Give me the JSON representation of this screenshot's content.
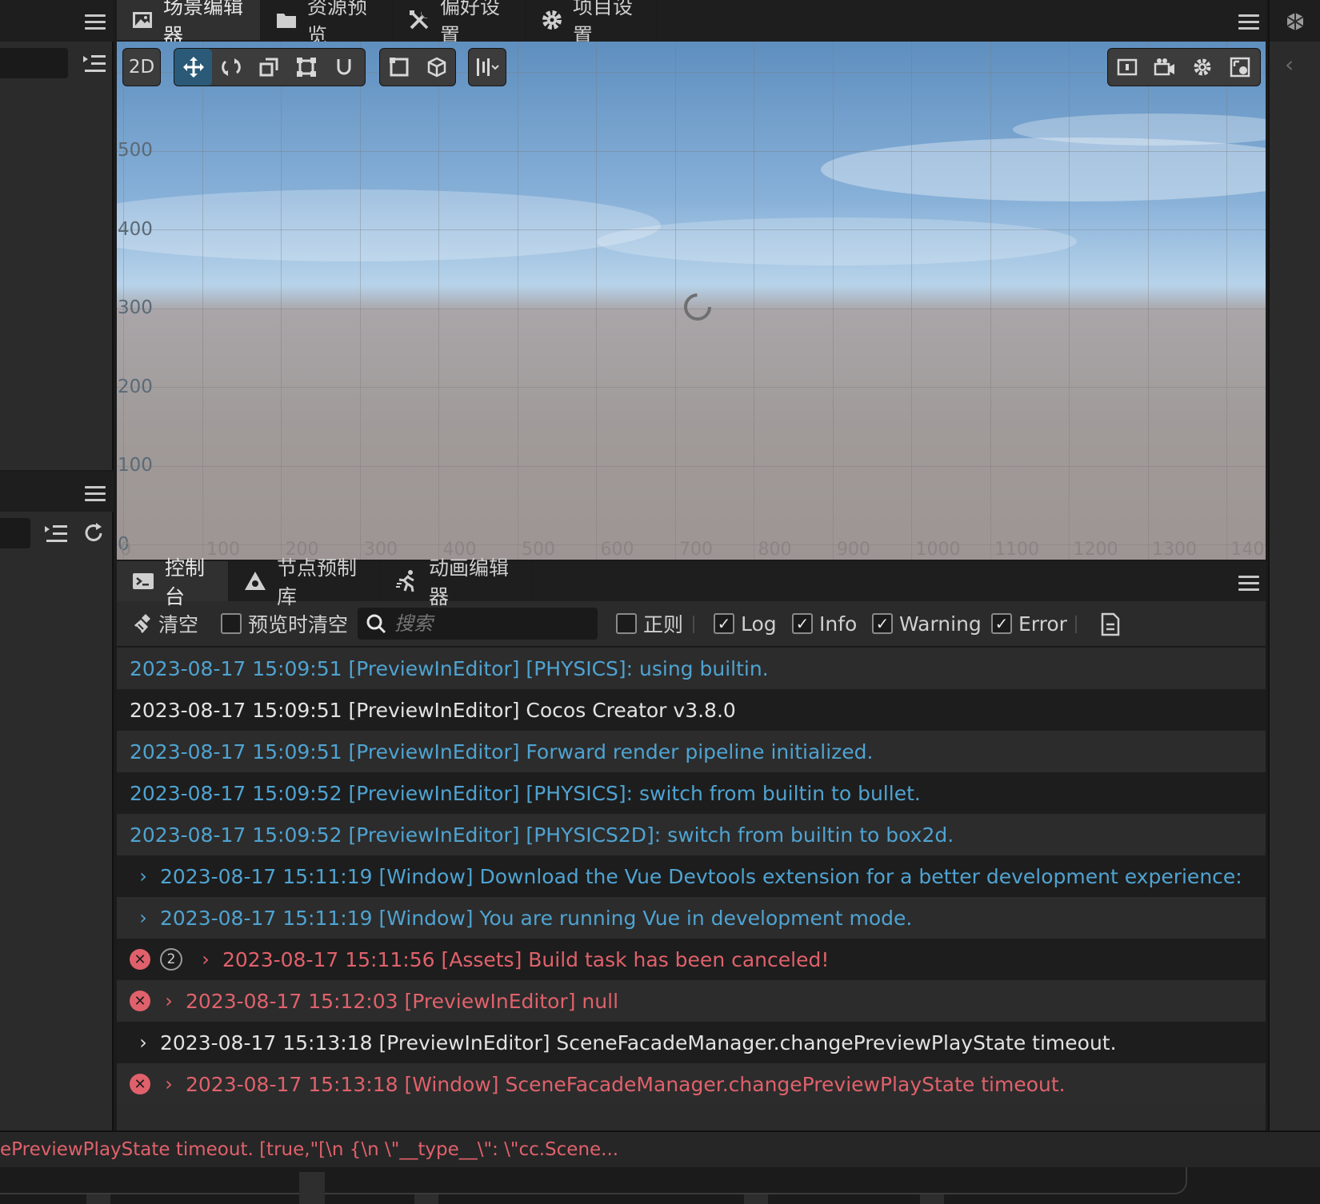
{
  "scene_tabs": [
    {
      "label": "场景编辑器",
      "icon": "image-icon",
      "active": true
    },
    {
      "label": "资源预览",
      "icon": "folder-icon",
      "active": false
    },
    {
      "label": "偏好设置",
      "icon": "tools-icon",
      "active": false
    },
    {
      "label": "项目设置",
      "icon": "gear-icon",
      "active": false
    }
  ],
  "toolbar": {
    "mode_2d": "2D"
  },
  "grid": {
    "y_labels": [
      "500",
      "400",
      "300",
      "200",
      "100",
      "0"
    ],
    "x_labels": [
      "0",
      "100",
      "200",
      "300",
      "400",
      "500",
      "600",
      "700",
      "800",
      "900",
      "1000",
      "1100",
      "1200",
      "1300",
      "140"
    ]
  },
  "bottom_tabs": [
    {
      "label": "控制台",
      "icon": "terminal-icon",
      "active": true
    },
    {
      "label": "节点预制库",
      "icon": "prefab-icon",
      "active": false
    },
    {
      "label": "动画编辑器",
      "icon": "runner-icon",
      "active": false
    }
  ],
  "console_toolbar": {
    "clear_label": "清空",
    "clear_on_preview_label": "预览时清空",
    "search_placeholder": "搜索",
    "regex_label": "正则",
    "log_label": "Log",
    "info_label": "Info",
    "warning_label": "Warning",
    "error_label": "Error",
    "regex_checked": false,
    "log_checked": true,
    "info_checked": true,
    "warning_checked": true,
    "error_checked": true
  },
  "console_rows": [
    {
      "level": "info",
      "text": "2023-08-17 15:09:51 [PreviewInEditor] [PHYSICS]: using builtin."
    },
    {
      "level": "log",
      "text": "2023-08-17 15:09:51 [PreviewInEditor] Cocos Creator v3.8.0"
    },
    {
      "level": "info",
      "text": "2023-08-17 15:09:51 [PreviewInEditor] Forward render pipeline initialized."
    },
    {
      "level": "info",
      "text": "2023-08-17 15:09:52 [PreviewInEditor] [PHYSICS]: switch from builtin to bullet."
    },
    {
      "level": "info",
      "text": "2023-08-17 15:09:52 [PreviewInEditor] [PHYSICS2D]: switch from builtin to box2d."
    },
    {
      "level": "info",
      "expandable": true,
      "text": "2023-08-17 15:11:19 [Window] Download the Vue Devtools extension for a better development experience:"
    },
    {
      "level": "info",
      "expandable": true,
      "text": "2023-08-17 15:11:19 [Window] You are running Vue in development mode."
    },
    {
      "level": "error",
      "expandable": true,
      "count": "2",
      "text": "2023-08-17 15:11:56 [Assets] Build task has been canceled!"
    },
    {
      "level": "error",
      "expandable": true,
      "text": "2023-08-17 15:12:03 [PreviewInEditor] null"
    },
    {
      "level": "log",
      "expandable": true,
      "text": "2023-08-17 15:13:18 [PreviewInEditor] SceneFacadeManager.changePreviewPlayState timeout."
    },
    {
      "level": "error",
      "expandable": true,
      "text": "2023-08-17 15:13:18 [Window] SceneFacadeManager.changePreviewPlayState timeout."
    }
  ],
  "status_bar": {
    "text": "ePreviewPlayState timeout. [true,\"[\\n {\\n \\\"__type__\\\": \\\"cc.Scene..."
  },
  "colors": {
    "info": "#4fa3d1",
    "log": "#e2e2e2",
    "error": "#e0616b",
    "active_tool": "#2a5a78"
  }
}
